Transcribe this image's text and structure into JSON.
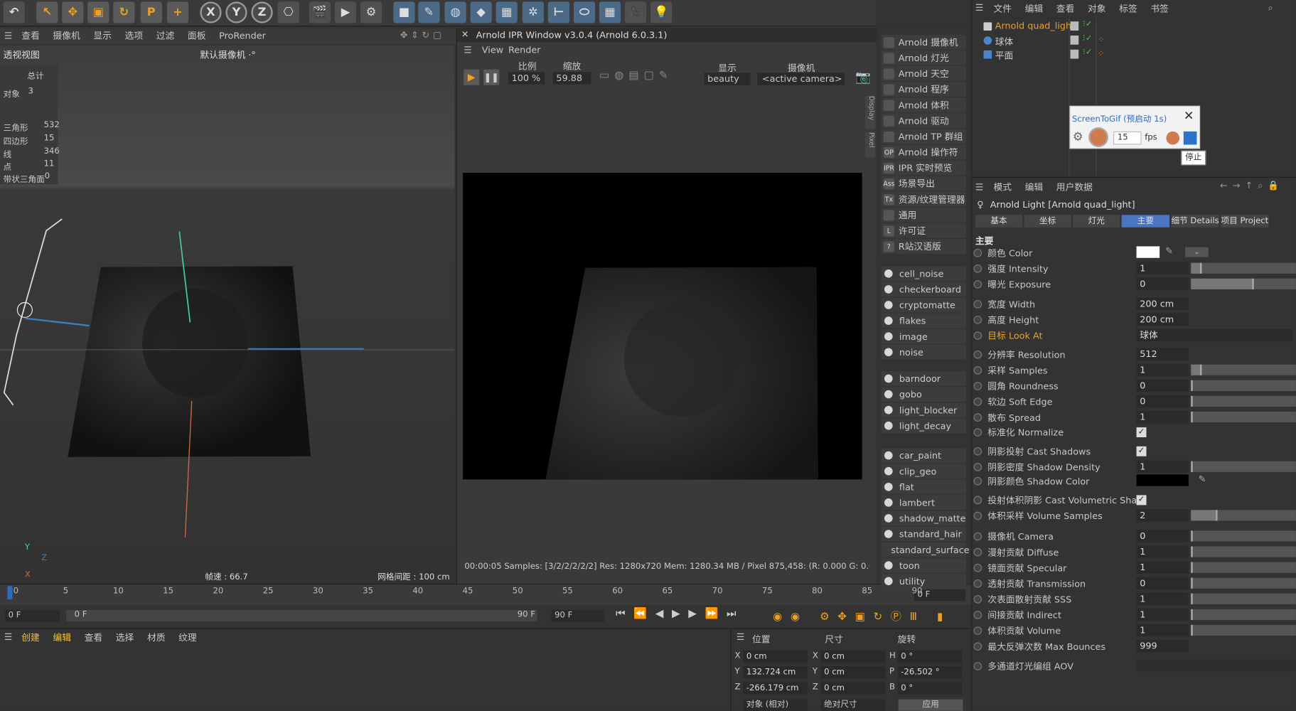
{
  "toolbar": {
    "icons": [
      "undo-icon",
      "select-icon",
      "move-icon",
      "scale-icon",
      "rotate-icon",
      "psr-icon",
      "add-icon",
      "x-axis-icon",
      "y-axis-icon",
      "z-axis-icon",
      "coord-icon",
      "clapboard-icon",
      "render-icon",
      "render-settings-icon",
      "cube-icon",
      "pen-icon",
      "sds-icon",
      "deformer-icon",
      "array-icon",
      "cloner-icon",
      "measure-icon",
      "shape-icon",
      "floor-icon",
      "camera-icon",
      "light-icon"
    ],
    "x": "X",
    "y": "Y",
    "z": "Z"
  },
  "viewport": {
    "menu": [
      "查看",
      "摄像机",
      "显示",
      "选项",
      "过滤",
      "面板",
      "ProRender"
    ],
    "title": "透视视图",
    "camera": "默认摄像机 ·°",
    "stats": {
      "header": "总计",
      "rows": [
        {
          "k": "对象",
          "v": "3"
        },
        {
          "k": "三角形",
          "v": "532"
        },
        {
          "k": "四边形",
          "v": "15"
        },
        {
          "k": "线",
          "v": "346"
        },
        {
          "k": "点",
          "v": "11"
        },
        {
          "k": "带状三角面",
          "v": "0"
        }
      ]
    },
    "fps": "帧速 : 66.7",
    "grid": "网格间距 : 100 cm",
    "axis": {
      "y": "Y",
      "z": "Z",
      "x": "X"
    }
  },
  "ipr": {
    "title": "Arnold IPR Window v3.0.4 (Arnold 6.0.3.1)",
    "menu": [
      "View",
      "Render"
    ],
    "ratio_label": "比例",
    "zoom_label": "缩放",
    "display_label": "显示",
    "camera_label": "摄像机",
    "ratio": "100 %",
    "zoom": "59.88 %",
    "display": "beauty",
    "camera": "<active camera>",
    "side_tabs": [
      "Display",
      "Pixel"
    ],
    "status": "00:00:05  Samples: [3/2/2/2/2/2]  Res: 1280x720  Mem: 1280.34 MB / Pixel 875,458: (R: 0.000 G: 0.000 B: 0.0"
  },
  "arnold_menu": [
    {
      "ic": "",
      "label": "Arnold 摄像机"
    },
    {
      "ic": "",
      "label": "Arnold 灯光"
    },
    {
      "ic": "",
      "label": "Arnold 天空"
    },
    {
      "ic": "",
      "label": "Arnold 程序"
    },
    {
      "ic": "",
      "label": "Arnold 体积"
    },
    {
      "ic": "",
      "label": "Arnold 驱动"
    },
    {
      "ic": "",
      "label": "Arnold TP 群组"
    },
    {
      "ic": "OP",
      "label": "Arnold 操作符"
    },
    {
      "ic": "IPR",
      "label": "IPR 实时预览"
    },
    {
      "ic": "Ass",
      "label": "场景导出"
    },
    {
      "ic": "Tx",
      "label": "资源/纹理管理器"
    },
    {
      "ic": "",
      "label": "通用"
    },
    {
      "ic": "L",
      "label": "许可证"
    },
    {
      "ic": "?",
      "label": "R站汉语版"
    }
  ],
  "shaders1": [
    "cell_noise",
    "checkerboard",
    "cryptomatte",
    "flakes",
    "image",
    "noise"
  ],
  "shaders2": [
    "barndoor",
    "gobo",
    "light_blocker",
    "light_decay"
  ],
  "shaders3": [
    "car_paint",
    "clip_geo",
    "flat",
    "lambert",
    "shadow_matte",
    "standard_hair",
    "standard_surface",
    "toon",
    "utility"
  ],
  "objects": {
    "menu": [
      "文件",
      "编辑",
      "查看",
      "对象",
      "标签",
      "书签"
    ],
    "items": [
      {
        "name": "Arnold quad_light",
        "active": true
      },
      {
        "name": "球体",
        "active": false
      },
      {
        "name": "平面",
        "active": false
      }
    ]
  },
  "gif": {
    "title": "ScreenToGif (预启动 1s)",
    "fps": "15",
    "fps_unit": "fps",
    "tooltip": "停止"
  },
  "attrs": {
    "menu": [
      "模式",
      "编辑",
      "用户数据"
    ],
    "title": "Arnold Light [Arnold quad_light]",
    "tabs": [
      "基本",
      "坐标",
      "灯光",
      "主要",
      "细节 Details",
      "项目 Project"
    ],
    "active_tab": "主要",
    "section": "主要",
    "color_label": "颜色 Color",
    "rows": [
      {
        "label": "强度 Intensity",
        "val": "1",
        "fill": 0.1
      },
      {
        "label": "曝光 Exposure",
        "val": "0",
        "fill": 0.6
      },
      {
        "label": "宽度 Width",
        "val": "200 cm"
      },
      {
        "label": "高度 Height",
        "val": "200 cm"
      },
      {
        "label": "目标 Look At",
        "val": "球体",
        "orange": true
      },
      {
        "label": "分辨率 Resolution",
        "val": "512"
      },
      {
        "label": "采样 Samples",
        "val": "1",
        "fill": 0.1
      },
      {
        "label": "圆角 Roundness",
        "val": "0",
        "fill": 0.01
      },
      {
        "label": "软边 Soft Edge",
        "val": "0",
        "fill": 0.01
      },
      {
        "label": "散布 Spread",
        "val": "1",
        "fill": 0.0
      },
      {
        "label": "标准化 Normalize",
        "check": true
      },
      {
        "label": "阴影投射 Cast Shadows",
        "check": true
      },
      {
        "label": "阴影密度 Shadow Density",
        "val": "1",
        "fill": 0.0
      },
      {
        "label": "阴影颜色 Shadow Color",
        "swatch": true
      },
      {
        "label": "投射体积阴影 Cast Volumetric Shadows",
        "check": true
      },
      {
        "label": "体积采样 Volume Samples",
        "val": "2",
        "fill": 0.25
      },
      {
        "label": "摄像机 Camera",
        "val": "0",
        "fill": 0.01
      },
      {
        "label": "漫射贡献 Diffuse",
        "val": "1",
        "fill": 0.0
      },
      {
        "label": "镜面贡献 Specular",
        "val": "1",
        "fill": 0.0
      },
      {
        "label": "透射贡献 Transmission",
        "val": "0",
        "fill": 0.01
      },
      {
        "label": "次表面散射贡献 SSS",
        "val": "1",
        "fill": 0.0
      },
      {
        "label": "间接贡献 Indirect",
        "val": "1",
        "fill": 0.0
      },
      {
        "label": "体积贡献 Volume",
        "val": "1",
        "fill": 0.0
      },
      {
        "label": "最大反弹次数 Max Bounces",
        "val": "999"
      },
      {
        "label": "多通道灯光编组 AOV",
        "empty": true
      }
    ]
  },
  "timeline": {
    "ticks": [
      "0",
      "5",
      "10",
      "15",
      "20",
      "25",
      "30",
      "35",
      "40",
      "45",
      "50",
      "55",
      "60",
      "65",
      "70",
      "75",
      "80",
      "85",
      "90"
    ],
    "frame_right": "0 F",
    "cur": "0 F",
    "start": "0 F",
    "end": "90 F",
    "end2": "90 F"
  },
  "materials": {
    "menu": [
      "创建",
      "编辑",
      "查看",
      "选择",
      "材质",
      "纹理"
    ]
  },
  "coords": {
    "headers": [
      "位置",
      "尺寸",
      "旋转"
    ],
    "pos": [
      {
        "k": "X",
        "v": "0 cm"
      },
      {
        "k": "Y",
        "v": "132.724 cm"
      },
      {
        "k": "Z",
        "v": "-266.179 cm"
      }
    ],
    "size": [
      {
        "k": "X",
        "v": "0 cm"
      },
      {
        "k": "Y",
        "v": "0 cm"
      },
      {
        "k": "Z",
        "v": "0 cm"
      }
    ],
    "rot": [
      {
        "k": "H",
        "v": "0 °"
      },
      {
        "k": "P",
        "v": "-26.502 °"
      },
      {
        "k": "B",
        "v": "0 °"
      }
    ],
    "mode1": "对象 (相对)",
    "mode2": "绝对尺寸",
    "apply": "应用"
  }
}
